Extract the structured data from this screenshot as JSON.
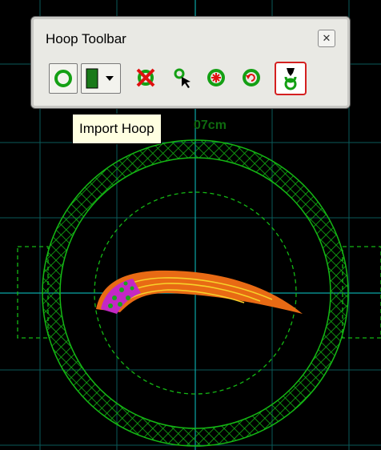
{
  "toolbar": {
    "title": "Hoop Toolbar",
    "close_glyph": "✕",
    "buttons": [
      {
        "name": "rotate-hoop-icon"
      },
      {
        "name": "hoop-color-dropdown"
      },
      {
        "name": "delete-hoop-icon"
      },
      {
        "name": "select-hoop-icon"
      },
      {
        "name": "center-hoop-icon"
      },
      {
        "name": "reset-rotation-icon"
      },
      {
        "name": "import-hoop-icon"
      }
    ]
  },
  "tooltip": {
    "text": "Import Hoop"
  },
  "dimension_label": {
    "text": "07cm"
  },
  "colors": {
    "grid": "#0a5a5a",
    "axis": "#0aa6a6",
    "hoop": "#14b814",
    "design_orange": "#e86a14",
    "design_yellow": "#f7d12a",
    "design_magenta": "#c428c4",
    "tooltip_bg": "#ffffe1"
  }
}
